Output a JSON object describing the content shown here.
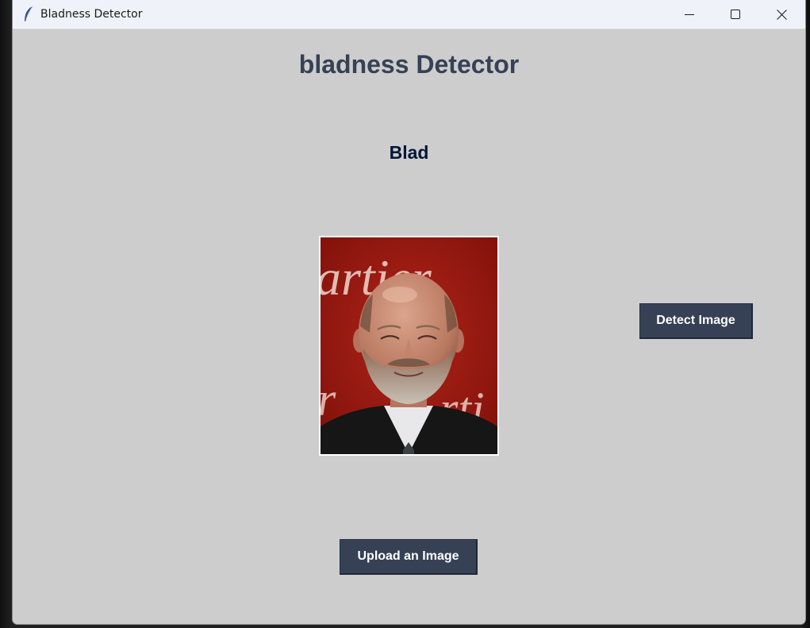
{
  "window": {
    "title": "Bladness Detector",
    "icon": "feather-icon",
    "controls": {
      "minimize": "minimize-icon",
      "maximize": "maximize-icon",
      "close": "close-icon"
    }
  },
  "main": {
    "heading": "bladness Detector",
    "result_label": "Blad",
    "image": {
      "description_icon": "uploaded-photo",
      "background_text": "artier"
    },
    "detect_button_label": "Detect Image",
    "upload_button_label": "Upload an Image"
  },
  "colors": {
    "window_bg": "#cdcdcd",
    "heading": "#364156",
    "result": "#011638",
    "button_bg": "#364156",
    "button_text": "#ffffff"
  }
}
